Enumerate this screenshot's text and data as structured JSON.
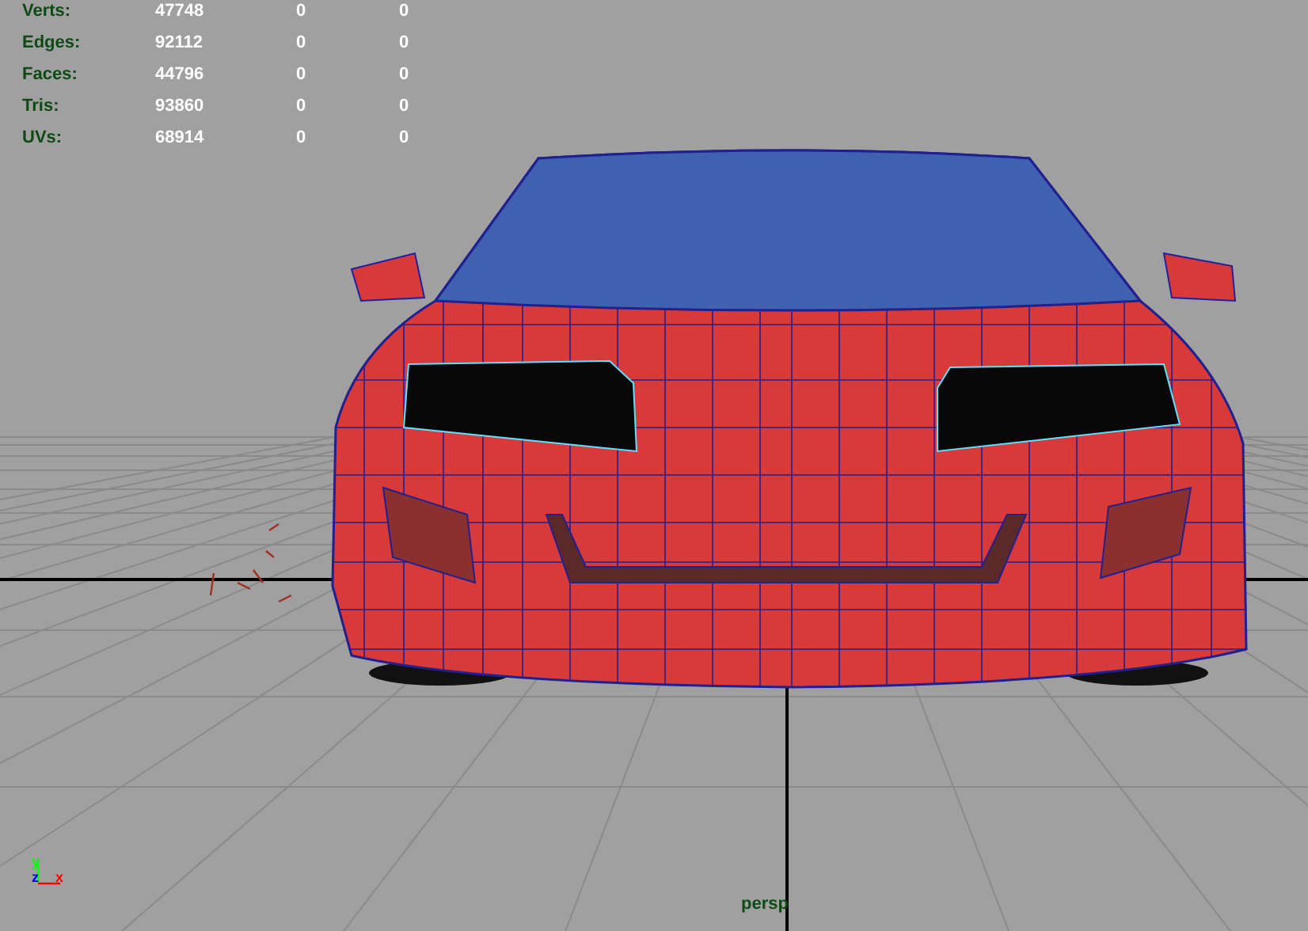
{
  "hud": {
    "rows": [
      {
        "label": "Verts:",
        "values": [
          "47748",
          "0",
          "0"
        ]
      },
      {
        "label": "Edges:",
        "values": [
          "92112",
          "0",
          "0"
        ]
      },
      {
        "label": "Faces:",
        "values": [
          "44796",
          "0",
          "0"
        ]
      },
      {
        "label": "Tris:",
        "values": [
          "93860",
          "0",
          "0"
        ]
      },
      {
        "label": "UVs:",
        "values": [
          "68914",
          "0",
          "0"
        ]
      }
    ]
  },
  "viewport": {
    "camera": "persp",
    "axes": [
      {
        "label": "y",
        "color": "#00ff00"
      },
      {
        "label": "z",
        "color": "#0000ff"
      },
      {
        "label": "x",
        "color": "#ff0000"
      }
    ]
  }
}
